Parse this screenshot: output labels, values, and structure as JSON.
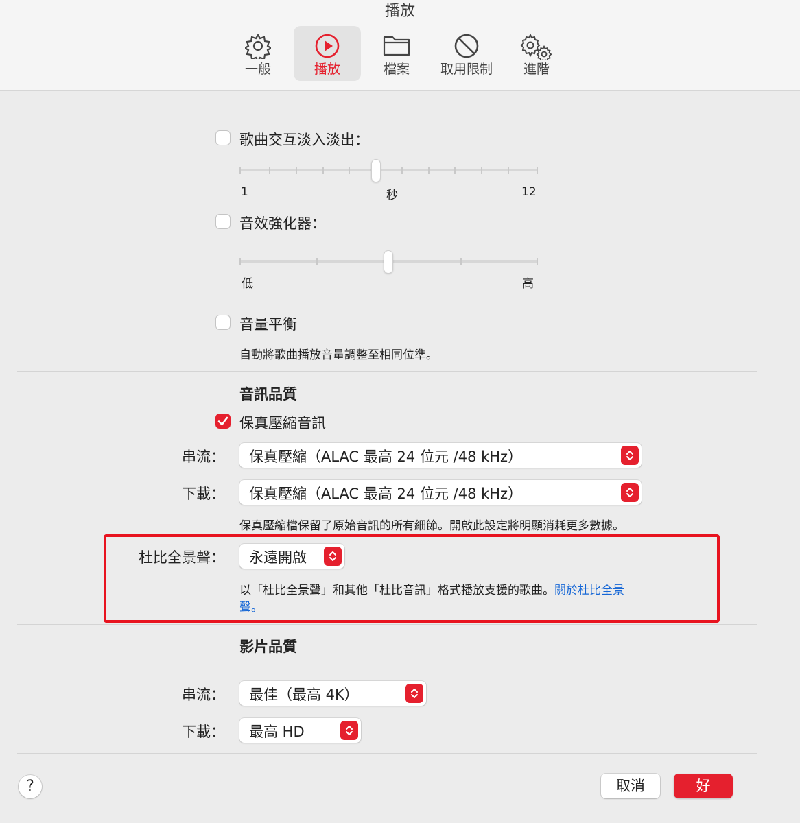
{
  "window": {
    "title": "播放"
  },
  "tabs": [
    {
      "label": "一般",
      "icon": "gear-icon"
    },
    {
      "label": "播放",
      "icon": "play-circle-icon",
      "active": true
    },
    {
      "label": "檔案",
      "icon": "folder-icon"
    },
    {
      "label": "取用限制",
      "icon": "prohibited-icon"
    },
    {
      "label": "進階",
      "icon": "gears-icon"
    }
  ],
  "crossfade": {
    "label": "歌曲交互淡入淡出：",
    "checked": false,
    "min_label": "1",
    "unit_label": "秒",
    "max_label": "12",
    "value": 6
  },
  "sound_enhancer": {
    "label": "音效強化器：",
    "checked": false,
    "low_label": "低",
    "high_label": "高",
    "level": 0.5
  },
  "sound_check": {
    "label": "音量平衡",
    "checked": false,
    "description": "自動將歌曲播放音量調整至相同位準。"
  },
  "audio_quality": {
    "heading": "音訊品質",
    "lossless_label": "保真壓縮音訊",
    "lossless_checked": true,
    "streaming_label": "串流：",
    "streaming_value": "保真壓縮（ALAC 最高 24 位元 /48 kHz）",
    "download_label": "下載：",
    "download_value": "保真壓縮（ALAC 最高 24 位元 /48 kHz）",
    "note": "保真壓縮檔保留了原始音訊的所有細節。開啟此設定將明顯消耗更多數據。"
  },
  "dolby_atmos": {
    "label": "杜比全景聲：",
    "value": "永遠開啟",
    "description": "以「杜比全景聲」和其他「杜比音訊」格式播放支援的歌曲。",
    "link_text_1": "關於杜比全景",
    "link_text_2": "聲。"
  },
  "video_quality": {
    "heading": "影片品質",
    "streaming_label": "串流：",
    "streaming_value": "最佳（最高 4K）",
    "download_label": "下載：",
    "download_value": "最高 HD"
  },
  "footer": {
    "help_label": "?",
    "cancel_label": "取消",
    "ok_label": "好"
  },
  "colors": {
    "accent": "#e5202e",
    "highlight_border": "#e8131f",
    "link": "#1667d6"
  }
}
